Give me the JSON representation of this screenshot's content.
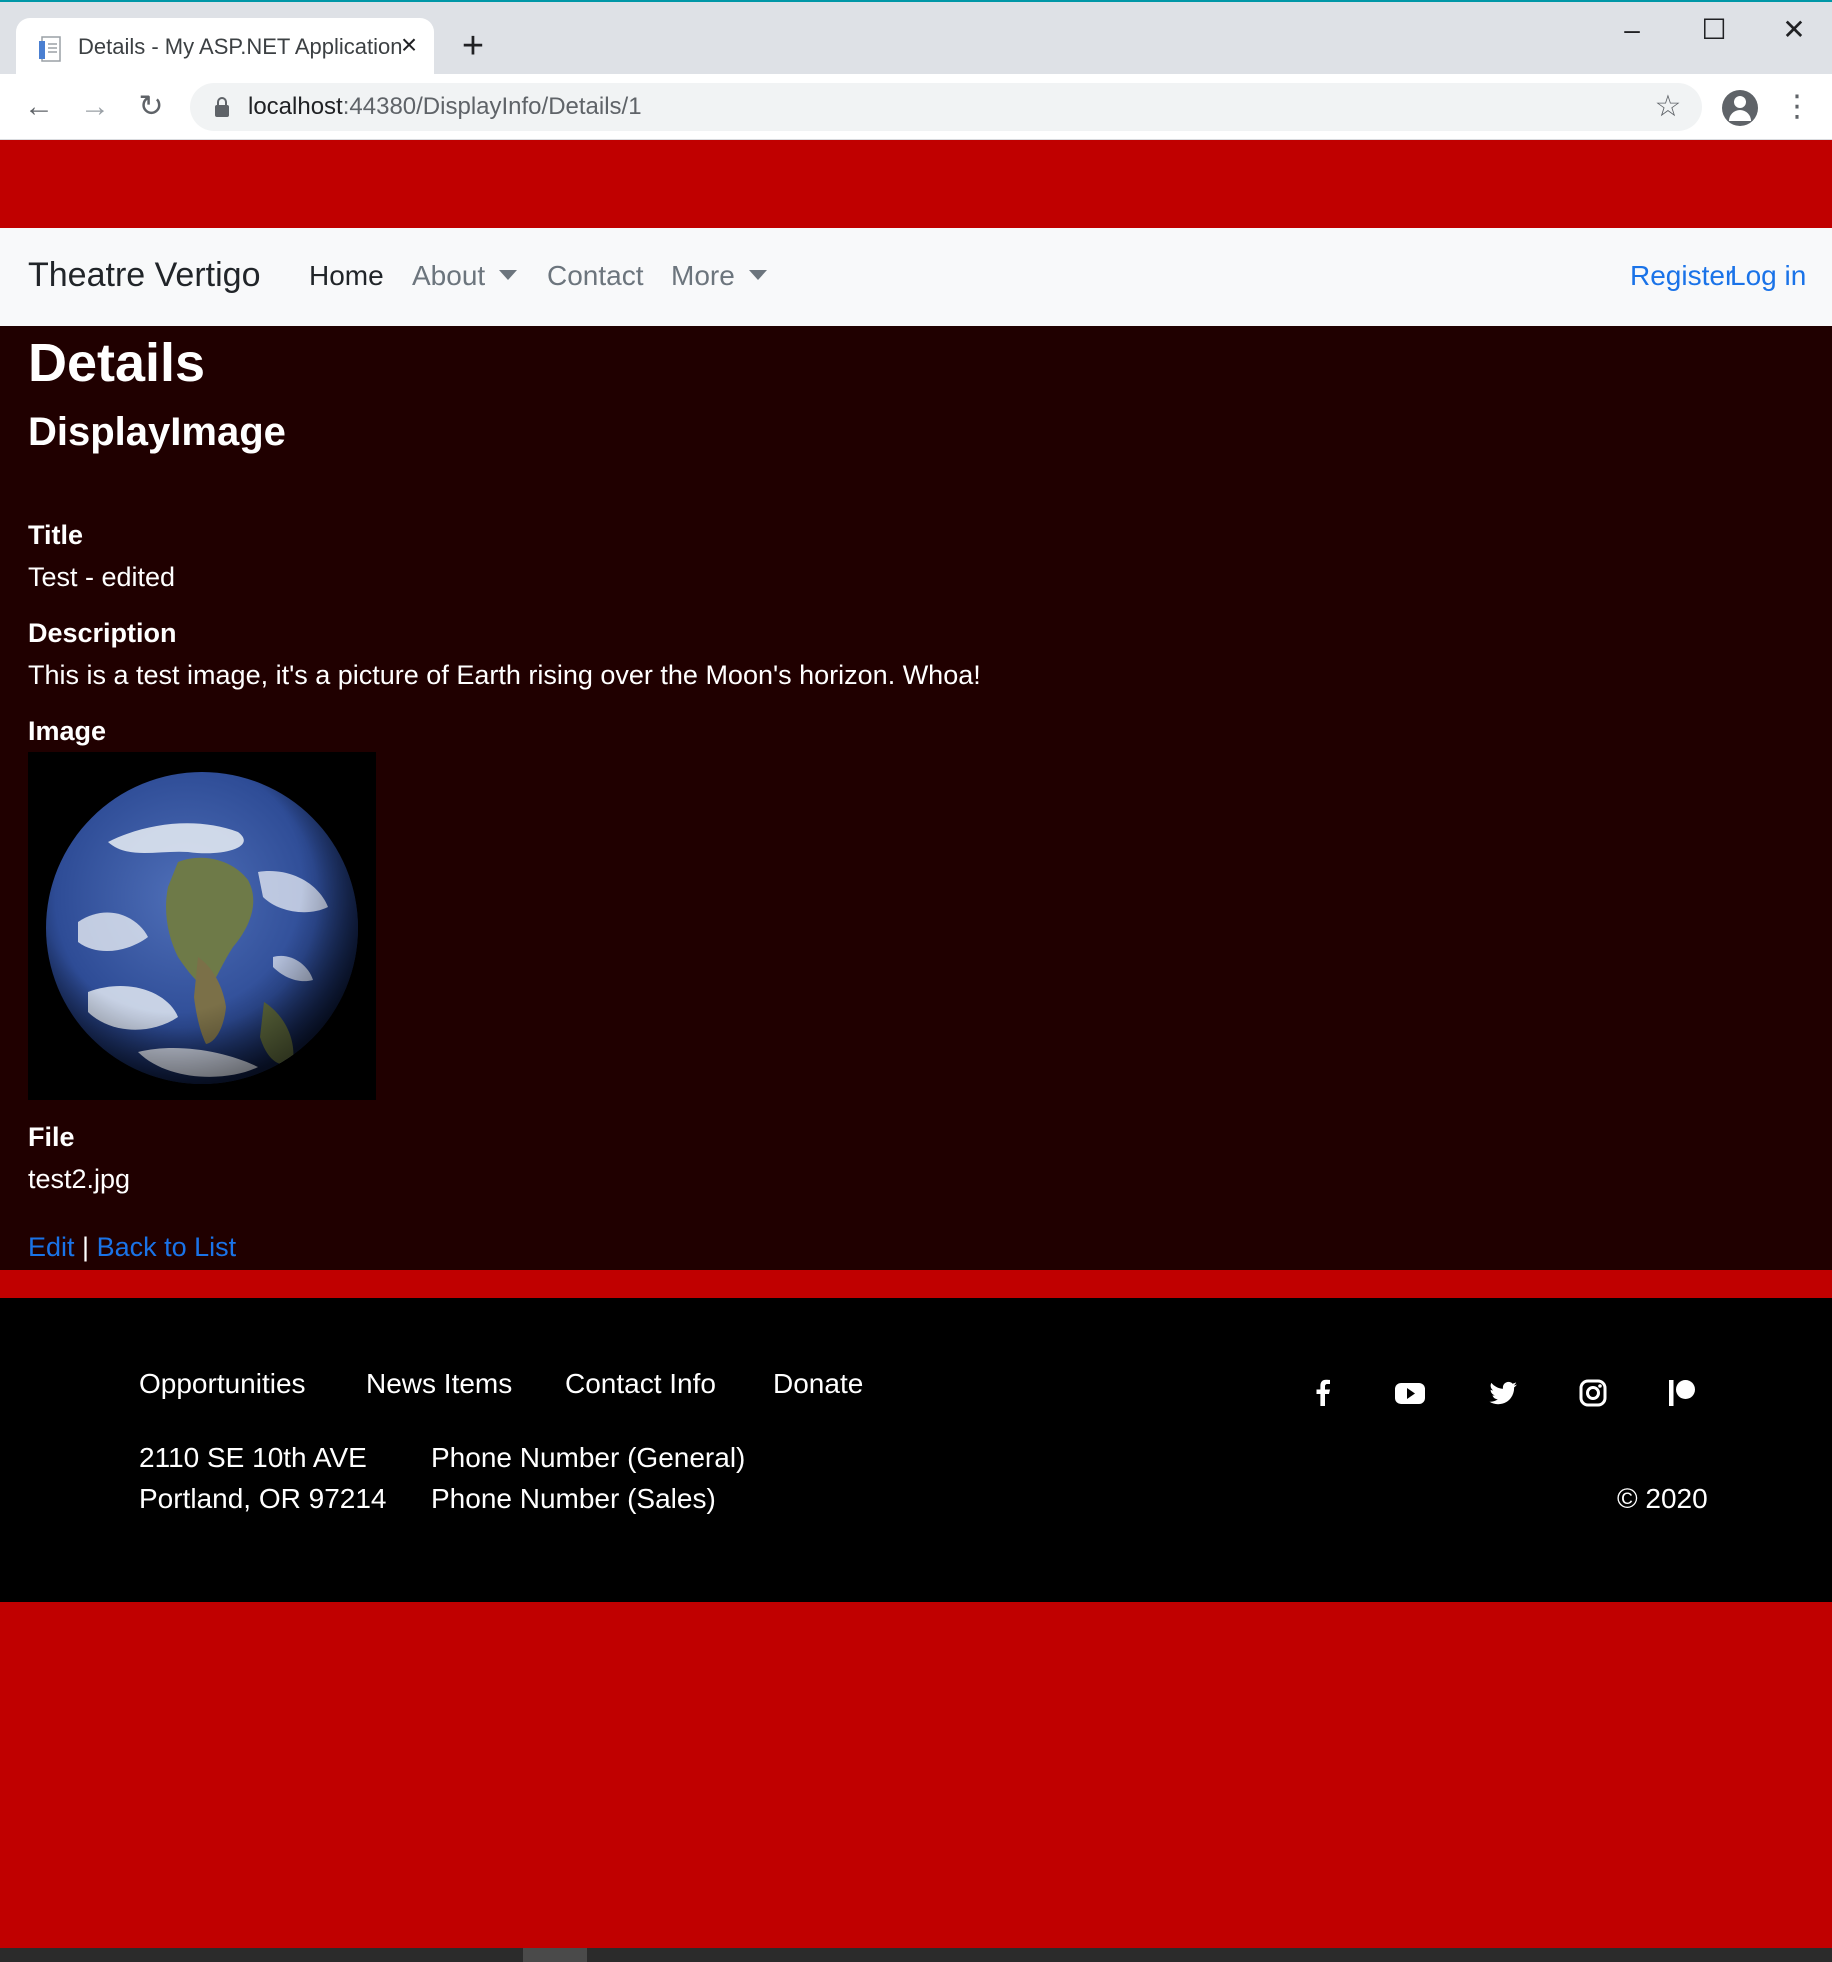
{
  "browser": {
    "tab_title": "Details - My ASP.NET Application",
    "new_tab_glyph": "+",
    "url_host": "localhost",
    "url_path": ":44380/DisplayInfo/Details/1"
  },
  "navbar": {
    "brand": "Theatre Vertigo",
    "items": [
      {
        "label": "Home",
        "active": true
      },
      {
        "label": "About",
        "dropdown": true
      },
      {
        "label": "Contact"
      },
      {
        "label": "More",
        "dropdown": true
      }
    ],
    "register": "Register",
    "login": "Log in"
  },
  "details": {
    "heading": "Details",
    "subheading": "DisplayImage",
    "fields": {
      "title_label": "Title",
      "title_value": "Test - edited",
      "description_label": "Description",
      "description_value": "This is a test image, it's a picture of Earth rising over the Moon's horizon. Whoa!",
      "image_label": "Image",
      "file_label": "File",
      "file_value": "test2.jpg"
    },
    "actions": {
      "edit": "Edit",
      "separator": " | ",
      "back": "Back to List"
    }
  },
  "footer": {
    "links": [
      "Opportunities",
      "News Items",
      "Contact Info",
      "Donate"
    ],
    "address_line1": "2110 SE 10th AVE",
    "address_line2": "Portland, OR 97214",
    "phone_general": "Phone Number (General)",
    "phone_sales": "Phone Number (Sales)",
    "copyright": "© 2020",
    "social_icons": [
      "facebook-icon",
      "youtube-icon",
      "twitter-icon",
      "instagram-icon",
      "patreon-icon"
    ]
  },
  "colors": {
    "accent_red": "#c00000",
    "content_bg": "#200000",
    "navbar_bg": "#f8f9fa",
    "link_blue": "#1a73e8",
    "footer_bg": "#000000"
  }
}
